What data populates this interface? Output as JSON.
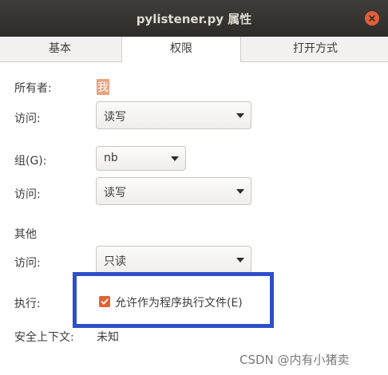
{
  "window": {
    "title": "pylistener.py 属性"
  },
  "tabs": [
    {
      "label": "基本"
    },
    {
      "label": "权限",
      "active": true
    },
    {
      "label": "打开方式"
    }
  ],
  "owner": {
    "label": "所有者:",
    "value": "我"
  },
  "owner_access": {
    "label": "访问:",
    "value": "读写"
  },
  "group": {
    "label": "组(G):",
    "value": "nb"
  },
  "group_access": {
    "label": "访问:",
    "value": "读写"
  },
  "others": {
    "heading": "其他",
    "access_label": "访问:",
    "access_value": "只读"
  },
  "execute": {
    "label": "执行:",
    "checkbox_label": "允许作为程序执行文件(E)",
    "checked": true
  },
  "security": {
    "label": "安全上下文:",
    "value": "未知"
  },
  "watermark": "CSDN @内有小猪卖",
  "colors": {
    "accent": "#e0632f",
    "titlebar": "#33312e",
    "annotation": "#2e4fc9"
  }
}
